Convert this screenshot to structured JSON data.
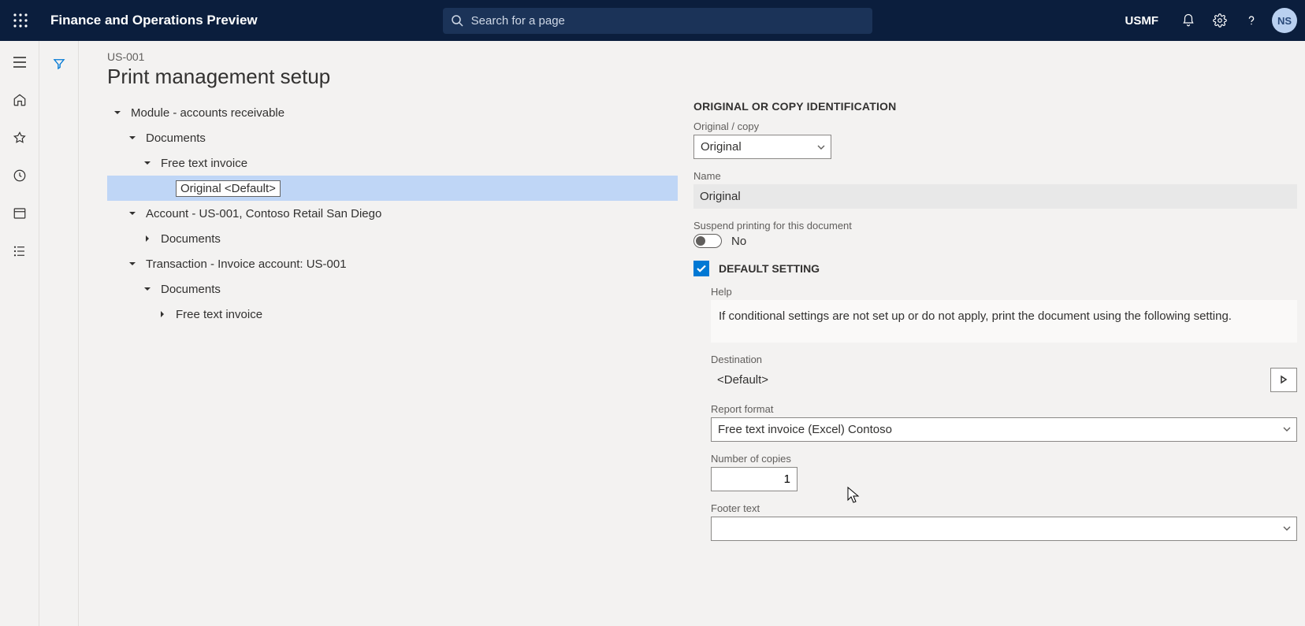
{
  "header": {
    "brand": "Finance and Operations Preview",
    "search_placeholder": "Search for a page",
    "legal_entity": "USMF",
    "avatar_initials": "NS"
  },
  "page": {
    "breadcrumb_id": "US-001",
    "title": "Print management setup"
  },
  "tree": {
    "n0": "Module - accounts receivable",
    "n1": "Documents",
    "n2": "Free text invoice",
    "n3": "Original <Default>",
    "n4": "Account - US-001, Contoso Retail San Diego",
    "n5": "Documents",
    "n6": "Transaction - Invoice account: US-001",
    "n7": "Documents",
    "n8": "Free text invoice"
  },
  "form": {
    "section1_heading": "ORIGINAL OR COPY IDENTIFICATION",
    "original_copy_label": "Original / copy",
    "original_copy_value": "Original",
    "name_label": "Name",
    "name_value": "Original",
    "suspend_label": "Suspend printing for this document",
    "suspend_value": "No",
    "default_setting_heading": "DEFAULT SETTING",
    "help_label": "Help",
    "help_text": "If conditional settings are not set up or do not apply, print the document using the following setting.",
    "destination_label": "Destination",
    "destination_value": "<Default>",
    "report_format_label": "Report format",
    "report_format_value": "Free text invoice (Excel) Contoso",
    "num_copies_label": "Number of copies",
    "num_copies_value": "1",
    "footer_text_label": "Footer text",
    "footer_text_value": ""
  }
}
